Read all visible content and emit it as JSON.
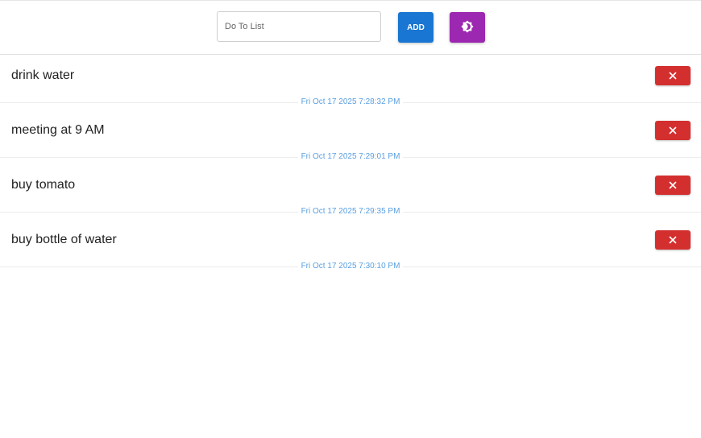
{
  "input": {
    "placeholder": "Do To List",
    "value": ""
  },
  "buttons": {
    "add_label": "ADD",
    "theme_icon": "brightness-icon",
    "delete_icon": "close-icon"
  },
  "colors": {
    "add": "#1976d2",
    "theme": "#9c27b0",
    "delete": "#d32f2f",
    "timestamp": "#5a9fe0"
  },
  "todos": [
    {
      "text": "drink water",
      "timestamp": "Fri Oct 17 2025 7:28:32 PM"
    },
    {
      "text": "meeting at 9 AM",
      "timestamp": "Fri Oct 17 2025 7:29:01 PM"
    },
    {
      "text": "buy tomato",
      "timestamp": "Fri Oct 17 2025 7:29:35 PM"
    },
    {
      "text": "buy bottle of water",
      "timestamp": "Fri Oct 17 2025 7:30:10 PM"
    }
  ]
}
